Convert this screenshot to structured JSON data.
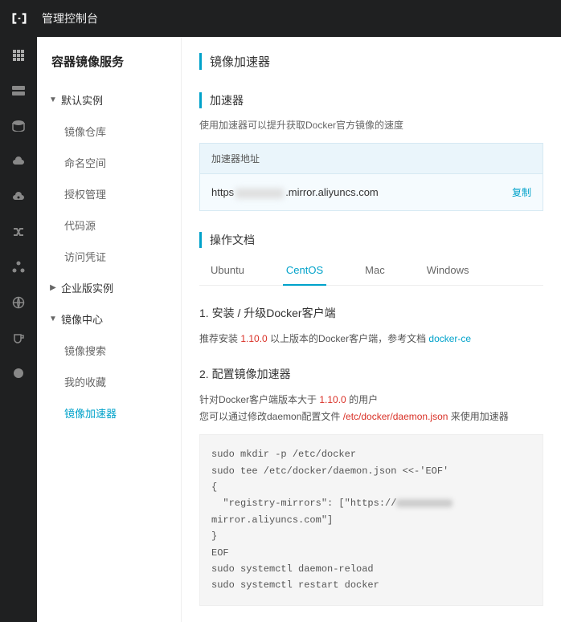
{
  "topbar": {
    "title": "管理控制台"
  },
  "sidebar": {
    "service_title": "容器镜像服务",
    "group1": {
      "label": "默认实例",
      "items": [
        "镜像仓库",
        "命名空间",
        "授权管理",
        "代码源",
        "访问凭证"
      ]
    },
    "group2": {
      "label": "企业版实例"
    },
    "group3": {
      "label": "镜像中心",
      "items": [
        "镜像搜索",
        "我的收藏",
        "镜像加速器"
      ]
    }
  },
  "main": {
    "page_title": "镜像加速器",
    "accel_title": "加速器",
    "accel_desc": "使用加速器可以提升获取Docker官方镜像的速度",
    "url_label": "加速器地址",
    "url_prefix": "https",
    "url_suffix": ".mirror.aliyuncs.com",
    "copy_label": "复制",
    "doc_title": "操作文档",
    "tabs": [
      "Ubuntu",
      "CentOS",
      "Mac",
      "Windows"
    ],
    "step1_title": "1. 安装 / 升级Docker客户端",
    "step1_prefix": "推荐安装 ",
    "step1_version": "1.10.0",
    "step1_suffix": " 以上版本的Docker客户端，参考文档 ",
    "step1_link": "docker-ce",
    "step2_title": "2. 配置镜像加速器",
    "step2_line1_prefix": "针对Docker客户端版本大于 ",
    "step2_line1_version": "1.10.0",
    "step2_line1_suffix": " 的用户",
    "step2_line2_prefix": "您可以通过修改daemon配置文件 ",
    "step2_line2_path": "/etc/docker/daemon.json",
    "step2_line2_suffix": " 来使用加速器",
    "code": {
      "l1": "sudo mkdir -p /etc/docker",
      "l2": "sudo tee /etc/docker/daemon.json <<-'EOF'",
      "l3": "{",
      "l4_a": "  \"registry-mirrors\": [\"https://",
      "l4_b": "mirror.aliyuncs.com\"]",
      "l5": "}",
      "l6": "EOF",
      "l7": "sudo systemctl daemon-reload",
      "l8": "sudo systemctl restart docker"
    }
  }
}
